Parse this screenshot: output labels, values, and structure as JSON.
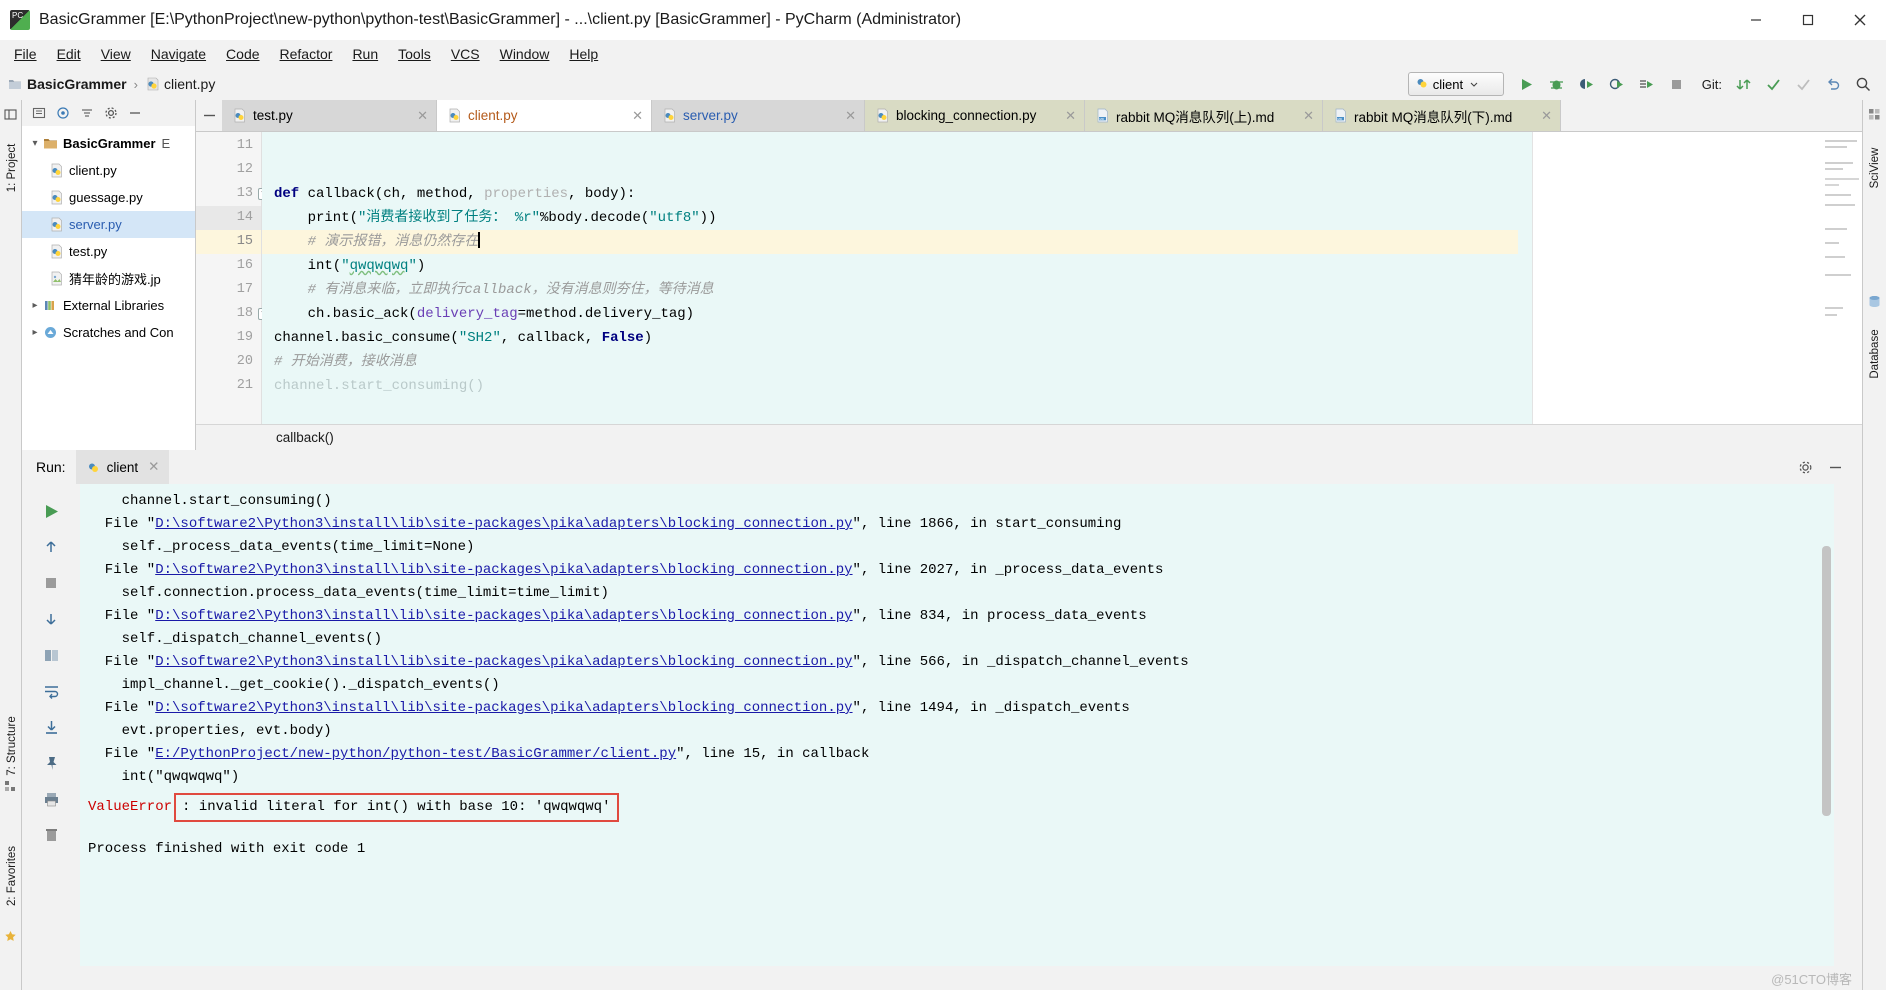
{
  "window": {
    "title": "BasicGrammer [E:\\PythonProject\\new-python\\python-test\\BasicGrammer] - ...\\client.py [BasicGrammer] - PyCharm (Administrator)",
    "app_icon": "pycharm-icon",
    "minimize_label": "—",
    "maximize_label": "☐",
    "close_label": "✕"
  },
  "menu": {
    "items": [
      {
        "label": "File",
        "mnemonic": "F"
      },
      {
        "label": "Edit",
        "mnemonic": "E"
      },
      {
        "label": "View",
        "mnemonic": "V"
      },
      {
        "label": "Navigate",
        "mnemonic": "N"
      },
      {
        "label": "Code",
        "mnemonic": "C"
      },
      {
        "label": "Refactor",
        "mnemonic": "R"
      },
      {
        "label": "Run",
        "mnemonic": "u"
      },
      {
        "label": "Tools",
        "mnemonic": "T"
      },
      {
        "label": "VCS",
        "mnemonic": "S"
      },
      {
        "label": "Window",
        "mnemonic": "W"
      },
      {
        "label": "Help",
        "mnemonic": "H"
      }
    ]
  },
  "navbar": {
    "breadcrumb": [
      "BasicGrammer",
      "client.py"
    ],
    "separator": "›",
    "run_config": "client",
    "git_label": "Git:",
    "buttons": [
      "run-button",
      "debug-button",
      "coverage-button",
      "profile-button",
      "run-with-button",
      "stop-button"
    ],
    "git_buttons": [
      "update-project-button",
      "commit-button",
      "push-button",
      "rollback-button"
    ],
    "search_button": "search-everywhere-icon"
  },
  "left_strip": {
    "items": [
      {
        "label": "1: Project",
        "name": "tool-window-project"
      },
      {
        "label": "7: Structure",
        "name": "tool-window-structure"
      },
      {
        "label": "2: Favorites",
        "name": "tool-window-favorites"
      }
    ]
  },
  "right_strip": {
    "items": [
      {
        "label": "SciView",
        "name": "tool-window-sciview"
      },
      {
        "label": "Database",
        "name": "tool-window-database"
      }
    ]
  },
  "project": {
    "toolbar_icons": [
      "expand-icon",
      "target-icon",
      "collapse-all-icon",
      "settings-icon",
      "hide-icon"
    ],
    "tree": [
      {
        "label": "BasicGrammer",
        "suffix": "E",
        "depth": 0,
        "arrow": "▾",
        "icon": "folder-icon",
        "bold": true,
        "selected": false
      },
      {
        "label": "client.py",
        "depth": 1,
        "arrow": "",
        "icon": "python-file-icon",
        "selected": false,
        "color": "default"
      },
      {
        "label": "guessage.py",
        "depth": 1,
        "arrow": "",
        "icon": "python-file-icon",
        "selected": false,
        "color": "default"
      },
      {
        "label": "server.py",
        "depth": 1,
        "arrow": "",
        "icon": "python-file-icon",
        "selected": true,
        "color": "blue"
      },
      {
        "label": "test.py",
        "depth": 1,
        "arrow": "",
        "icon": "python-file-icon",
        "selected": false,
        "color": "default"
      },
      {
        "label": "猜年龄的游戏.jp",
        "depth": 1,
        "arrow": "",
        "icon": "image-file-icon",
        "selected": false,
        "color": "default"
      },
      {
        "label": "External Libraries",
        "depth": 0,
        "arrow": "▸",
        "icon": "library-icon",
        "selected": false,
        "color": "default"
      },
      {
        "label": "Scratches and Con",
        "depth": 0,
        "arrow": "▸",
        "icon": "scratches-icon",
        "selected": false,
        "color": "default"
      }
    ]
  },
  "editor": {
    "tabs": [
      {
        "label": "test.py",
        "icon": "python-file-icon",
        "active": false,
        "style": "normal",
        "close": "✕"
      },
      {
        "label": "client.py",
        "icon": "python-file-icon",
        "active": true,
        "style": "orange",
        "close": "✕"
      },
      {
        "label": "server.py",
        "icon": "python-file-icon",
        "active": false,
        "style": "blue",
        "close": "✕"
      },
      {
        "label": "blocking_connection.py",
        "icon": "python-file-icon",
        "active": false,
        "style": "normal",
        "close": "✕"
      },
      {
        "label": "rabbit MQ消息队列(上).md",
        "icon": "markdown-file-icon",
        "active": false,
        "style": "md",
        "close": "✕"
      },
      {
        "label": "rabbit MQ消息队列(下).md",
        "icon": "markdown-file-icon",
        "active": false,
        "style": "md",
        "close": "✕"
      }
    ],
    "current_line": 15,
    "lines": [
      {
        "num": 11,
        "text": ""
      },
      {
        "num": 12,
        "text": ""
      },
      {
        "num": 13,
        "text": "def callback(ch, method, properties, body):"
      },
      {
        "num": 14,
        "text": "    print(\"消费者接收到了任务： %r\"%body.decode(\"utf8\"))"
      },
      {
        "num": 15,
        "text": "    # 演示报错，消息仍然存在"
      },
      {
        "num": 16,
        "text": "    int(\"qwqwqwq\")"
      },
      {
        "num": 17,
        "text": "    # 有消息来临，立即执行callback，没有消息则夺住，等待消息"
      },
      {
        "num": 18,
        "text": "    ch.basic_ack(delivery_tag=method.delivery_tag)"
      },
      {
        "num": 19,
        "text": "channel.basic_consume(\"SH2\", callback, False)"
      },
      {
        "num": 20,
        "text": "# 开始消费，接收消息"
      },
      {
        "num": 21,
        "text": "channel.start_consuming()"
      }
    ],
    "breadcrumb_bottom": "callback()"
  },
  "run_panel": {
    "title": "Run:",
    "tab_label": "client",
    "tab_close": "✕",
    "sidebar_buttons": [
      "rerun-button",
      "scroll-up-button",
      "stop-button",
      "scroll-down-button",
      "print-layout-button",
      "soft-wrap-button",
      "scroll-to-end-button",
      "pin-tab-button",
      "print-button",
      "clear-all-button"
    ],
    "header_buttons": [
      "settings-icon",
      "hide-icon"
    ],
    "console_lines": [
      {
        "type": "plain",
        "text": "    channel.start_consuming()"
      },
      {
        "type": "file",
        "pre": "  File \"",
        "link": "D:\\software2\\Python3\\install\\lib\\site-packages\\pika\\adapters\\blocking_connection.py",
        "post": "\", line 1866, in start_consuming"
      },
      {
        "type": "plain",
        "text": "    self._process_data_events(time_limit=None)"
      },
      {
        "type": "file",
        "pre": "  File \"",
        "link": "D:\\software2\\Python3\\install\\lib\\site-packages\\pika\\adapters\\blocking_connection.py",
        "post": "\", line 2027, in _process_data_events"
      },
      {
        "type": "plain",
        "text": "    self.connection.process_data_events(time_limit=time_limit)"
      },
      {
        "type": "file",
        "pre": "  File \"",
        "link": "D:\\software2\\Python3\\install\\lib\\site-packages\\pika\\adapters\\blocking_connection.py",
        "post": "\", line 834, in process_data_events"
      },
      {
        "type": "plain",
        "text": "    self._dispatch_channel_events()"
      },
      {
        "type": "file",
        "pre": "  File \"",
        "link": "D:\\software2\\Python3\\install\\lib\\site-packages\\pika\\adapters\\blocking_connection.py",
        "post": "\", line 566, in _dispatch_channel_events"
      },
      {
        "type": "plain",
        "text": "    impl_channel._get_cookie()._dispatch_events()"
      },
      {
        "type": "file",
        "pre": "  File \"",
        "link": "D:\\software2\\Python3\\install\\lib\\site-packages\\pika\\adapters\\blocking_connection.py",
        "post": "\", line 1494, in _dispatch_events"
      },
      {
        "type": "plain",
        "text": "    evt.properties, evt.body)"
      },
      {
        "type": "file",
        "pre": "  File \"",
        "link": "E:/PythonProject/new-python/python-test/BasicGrammer/client.py",
        "post": "\", line 15, in callback"
      },
      {
        "type": "plain",
        "text": "    int(\"qwqwqwq\")"
      }
    ],
    "error": {
      "type": "ValueError",
      "message": ": invalid literal for int() with base 10: 'qwqwqwq'"
    },
    "exit_line": "Process finished with exit code 1"
  },
  "status": {
    "watermark": "@51CTO博客"
  }
}
